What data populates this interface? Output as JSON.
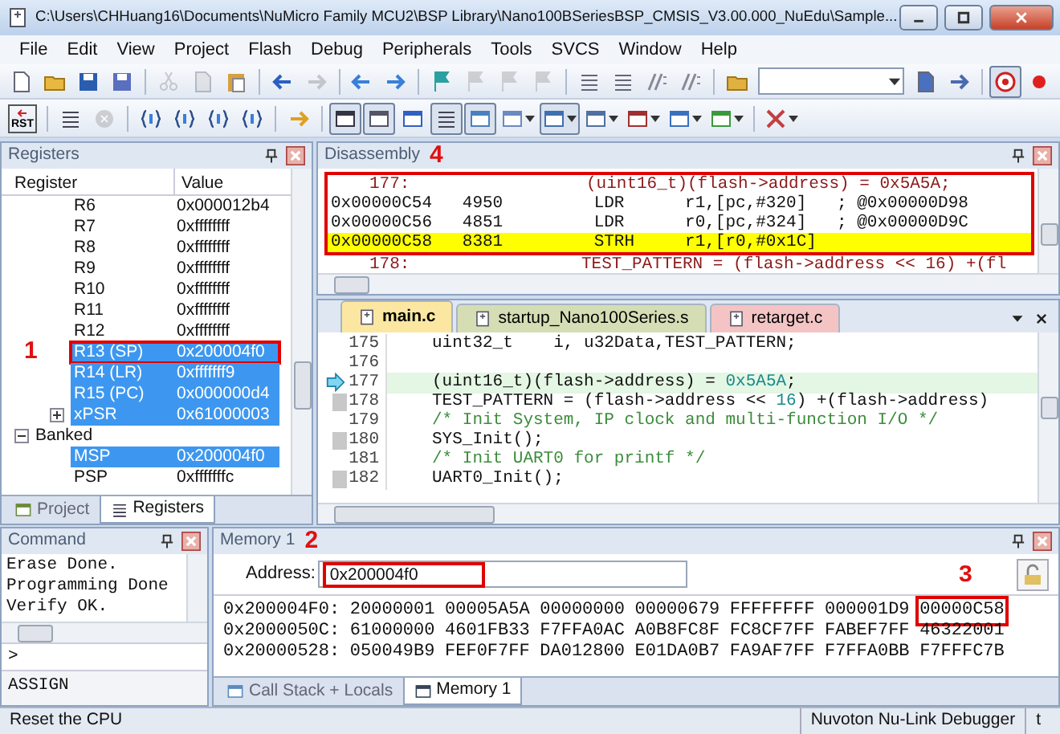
{
  "window": {
    "title": "C:\\Users\\CHHuang16\\Documents\\NuMicro Family MCU2\\BSP Library\\Nano100BSeriesBSP_CMSIS_V3.00.000_NuEdu\\Sample..."
  },
  "menu": [
    "File",
    "Edit",
    "View",
    "Project",
    "Flash",
    "Debug",
    "Peripherals",
    "Tools",
    "SVCS",
    "Window",
    "Help"
  ],
  "file_toolbar": [
    {
      "disabled": false,
      "pressed": false
    },
    {
      "disabled": false,
      "pressed": false
    },
    {
      "disabled": false,
      "pressed": false
    },
    {
      "disabled": false,
      "pressed": false
    },
    {
      "disabled": true,
      "pressed": false
    },
    {
      "disabled": true,
      "pressed": false
    },
    {
      "disabled": false,
      "pressed": false
    },
    {
      "disabled": false,
      "pressed": false
    },
    {
      "disabled": true,
      "pressed": false
    },
    {
      "disabled": false,
      "pressed": false
    },
    {
      "disabled": false,
      "pressed": false
    },
    {
      "disabled": false,
      "pressed": false
    },
    {
      "disabled": true,
      "pressed": false
    },
    {
      "disabled": true,
      "pressed": false
    },
    {
      "disabled": true,
      "pressed": false
    },
    {
      "disabled": false,
      "pressed": false
    },
    {
      "disabled": false,
      "pressed": false
    },
    {
      "disabled": false,
      "pressed": false
    },
    {
      "disabled": false,
      "pressed": false
    },
    {
      "disabled": false,
      "pressed": false
    },
    {
      "disabled": false,
      "pressed": false
    },
    {
      "disabled": false,
      "pressed": false
    },
    {
      "disabled": false,
      "pressed": true
    },
    {
      "disabled": false,
      "pressed": false
    }
  ],
  "debug_toolbar": {
    "reset_label": "RST",
    "buttons": [
      {
        "disabled": false,
        "pressed": false
      },
      {
        "disabled": false,
        "pressed": false
      },
      {
        "disabled": true,
        "pressed": false
      },
      {
        "disabled": false,
        "pressed": false
      },
      {
        "disabled": false,
        "pressed": false
      },
      {
        "disabled": false,
        "pressed": false
      },
      {
        "disabled": false,
        "pressed": false
      },
      {
        "disabled": false,
        "pressed": false
      },
      {
        "disabled": false,
        "pressed": true
      },
      {
        "disabled": false,
        "pressed": true
      },
      {
        "disabled": false,
        "pressed": false
      },
      {
        "disabled": false,
        "pressed": true
      },
      {
        "disabled": false,
        "pressed": true
      },
      {
        "disabled": false,
        "pressed": false
      },
      {
        "disabled": false,
        "pressed": true
      },
      {
        "disabled": false,
        "pressed": false
      },
      {
        "disabled": false,
        "pressed": false
      },
      {
        "disabled": false,
        "pressed": false
      },
      {
        "disabled": false,
        "pressed": false
      },
      {
        "disabled": false,
        "pressed": false
      }
    ]
  },
  "registers": {
    "title": "Registers",
    "columns": [
      "Register",
      "Value"
    ],
    "rows": [
      {
        "kind": "register",
        "name": "R6",
        "value": "0x000012b4",
        "selected": false
      },
      {
        "kind": "register",
        "name": "R7",
        "value": "0xffffffff",
        "selected": false
      },
      {
        "kind": "register",
        "name": "R8",
        "value": "0xffffffff",
        "selected": false
      },
      {
        "kind": "register",
        "name": "R9",
        "value": "0xffffffff",
        "selected": false
      },
      {
        "kind": "register",
        "name": "R10",
        "value": "0xffffffff",
        "selected": false
      },
      {
        "kind": "register",
        "name": "R11",
        "value": "0xffffffff",
        "selected": false
      },
      {
        "kind": "register",
        "name": "R12",
        "value": "0xffffffff",
        "selected": false
      },
      {
        "kind": "register",
        "name": "R13 (SP)",
        "value": "0x200004f0",
        "selected": true,
        "boxed": true,
        "callout": "1"
      },
      {
        "kind": "register",
        "name": "R14 (LR)",
        "value": "0xfffffff9",
        "selected": true
      },
      {
        "kind": "register",
        "name": "R15 (PC)",
        "value": "0x000000d4",
        "selected": true
      },
      {
        "kind": "node",
        "name": "xPSR",
        "value": "0x61000003",
        "selected": true,
        "expanded": false
      },
      {
        "kind": "group",
        "name": "Banked",
        "expanded": true,
        "children": [
          {
            "kind": "register",
            "name": "MSP",
            "value": "0x200004f0",
            "selected": true
          },
          {
            "kind": "register",
            "name": "PSP",
            "value": "0xfffffffc",
            "selected": false
          }
        ]
      }
    ],
    "tabs": [
      {
        "label": "Project",
        "selected": false
      },
      {
        "label": "Registers",
        "selected": true
      }
    ]
  },
  "disassembly": {
    "title": "Disassembly",
    "callout": "4",
    "lines": [
      {
        "kind": "source",
        "line": "177:",
        "text": "(uint16_t)(flash->address) = 0x5A5A;",
        "boxed": true,
        "current": false
      },
      {
        "kind": "instruction",
        "address": "0x00000C54",
        "opcode": "4950",
        "mnemonic": "LDR",
        "operands": "r1,[pc,#320]",
        "comment": "; @0x00000D98",
        "boxed": true,
        "current": false
      },
      {
        "kind": "instruction",
        "address": "0x00000C56",
        "opcode": "4851",
        "mnemonic": "LDR",
        "operands": "r0,[pc,#324]",
        "comment": "; @0x00000D9C",
        "boxed": true,
        "current": false
      },
      {
        "kind": "instruction",
        "address": "0x00000C58",
        "opcode": "8381",
        "mnemonic": "STRH",
        "operands": "r1,[r0,#0x1C]",
        "boxed": true,
        "current": true
      },
      {
        "kind": "source",
        "line": "178:",
        "text": "TEST_PATTERN = (flash->address << 16) +(fl",
        "boxed": false,
        "current": false
      }
    ]
  },
  "editor": {
    "tabs": [
      {
        "label": "main.c",
        "selected": true,
        "color": "#fbe7a1"
      },
      {
        "label": "startup_Nano100Series.s",
        "selected": false,
        "color": "#d5ddb5"
      },
      {
        "label": "retarget.c",
        "selected": false,
        "color": "#f4c4c4"
      }
    ],
    "lines": [
      {
        "number": "175",
        "executable": false,
        "current": false,
        "segments": [
          {
            "kind": "code",
            "text": "uint32_t    i, u32Data,TEST_PATTERN;"
          }
        ]
      },
      {
        "number": "176",
        "executable": false,
        "current": false
      },
      {
        "number": "177",
        "executable": false,
        "current": true,
        "segments": [
          {
            "kind": "code",
            "text": "(uint16_t)(flash->address) = "
          },
          {
            "kind": "number",
            "text": "0x5A5A"
          },
          {
            "kind": "code",
            "text": ";"
          }
        ]
      },
      {
        "number": "178",
        "executable": true,
        "current": false,
        "segments": [
          {
            "kind": "code",
            "text": "TEST_PATTERN = (flash->address << "
          },
          {
            "kind": "number",
            "text": "16"
          },
          {
            "kind": "code",
            "text": ") +(flash->address)"
          }
        ]
      },
      {
        "number": "179",
        "executable": false,
        "current": false,
        "segments": [
          {
            "kind": "comment",
            "text": "/* Init System, IP clock and multi-function I/O */"
          }
        ]
      },
      {
        "number": "180",
        "executable": true,
        "current": false,
        "segments": [
          {
            "kind": "code",
            "text": "SYS_Init();"
          }
        ]
      },
      {
        "number": "181",
        "executable": false,
        "current": false,
        "segments": [
          {
            "kind": "comment",
            "text": "/* Init UART0 for printf */"
          }
        ]
      },
      {
        "number": "182",
        "executable": true,
        "current": false,
        "segments": [
          {
            "kind": "code",
            "text": "UART0_Init();"
          }
        ]
      }
    ]
  },
  "command": {
    "title": "Command",
    "output": [
      "Erase Done.",
      "Programming Done",
      "Verify OK."
    ],
    "prompt": ">",
    "hint": "ASSIGN"
  },
  "memory": {
    "title": "Memory 1",
    "address_label": "Address:",
    "address": "0x200004f0",
    "address_callout": "2",
    "rows": [
      {
        "address": "0x200004F0:",
        "values": [
          {
            "text": "20000001"
          },
          {
            "text": "00005A5A"
          },
          {
            "text": "00000000"
          },
          {
            "text": "00000679"
          },
          {
            "text": "FFFFFFFF"
          },
          {
            "text": "000001D9"
          },
          {
            "text": "00000C58",
            "boxed": true,
            "callout": "3"
          }
        ]
      },
      {
        "address": "0x2000050C:",
        "values": [
          {
            "text": "61000000"
          },
          {
            "text": "4601FB33"
          },
          {
            "text": "F7FFA0AC"
          },
          {
            "text": "A0B8FC8F"
          },
          {
            "text": "FC8CF7FF"
          },
          {
            "text": "FABEF7FF"
          },
          {
            "text": "46322001"
          }
        ]
      },
      {
        "address": "0x20000528:",
        "values": [
          {
            "text": "050049B9"
          },
          {
            "text": "FEF0F7FF"
          },
          {
            "text": "DA012800"
          },
          {
            "text": "E01DA0B7"
          },
          {
            "text": "FA9AF7FF"
          },
          {
            "text": "F7FFA0BB"
          },
          {
            "text": "F7FFFC7B"
          }
        ]
      }
    ],
    "tabs": [
      {
        "label": "Call Stack + Locals",
        "selected": false
      },
      {
        "label": "Memory 1",
        "selected": true
      }
    ]
  },
  "status_bar": {
    "message": "Reset the CPU",
    "debugger": "Nuvoton Nu-Link Debugger",
    "extra": "t"
  }
}
